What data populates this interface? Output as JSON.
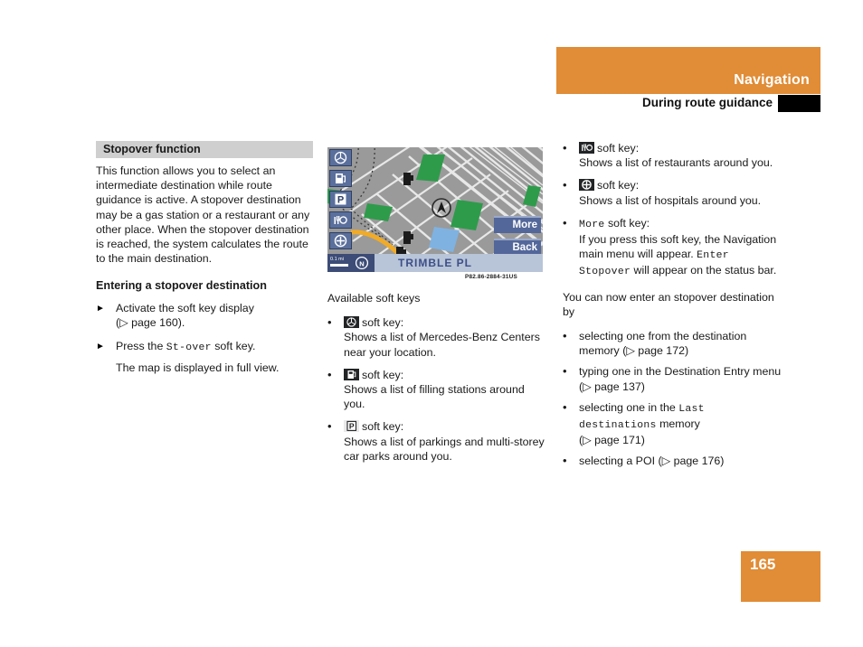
{
  "header": {
    "title": "Navigation",
    "subtitle": "During route guidance",
    "accent_color": "#e18c36",
    "bar_color": "#000000"
  },
  "left_column": {
    "section_heading": "Stopover function",
    "intro": "This function allows you to select an intermediate destination while route guidance is active. A stopover destination may be a gas station or a restaurant or any other place. When the stopover destination is reached, the system calculates the route to the main destination.",
    "sub_heading": "Entering a stopover destination",
    "steps": [
      {
        "text_before": "Activate the soft key display",
        "ref": "(▷ page 160).",
        "mono": "",
        "text_after": ""
      },
      {
        "text_before": "Press the ",
        "mono": "St-over",
        "text_after": " soft key.",
        "ref": ""
      }
    ],
    "step_note": "The map is displayed in full view."
  },
  "figure": {
    "code": "P82.86-2884-31US",
    "street_label": "TRIMBLE PL",
    "scale_label": "0.1 mi",
    "north_icon": "compass-north-icon",
    "soft_keys_left": [
      {
        "name": "mercedes-star-key",
        "label": "Mercedes-Benz Centers"
      },
      {
        "name": "fuel-pump-key",
        "label": "Filling stations"
      },
      {
        "name": "parking-key",
        "label": "Parkings"
      },
      {
        "name": "restaurant-key",
        "label": "Restaurants"
      },
      {
        "name": "hospital-key",
        "label": "Hospitals"
      }
    ],
    "soft_keys_right": [
      {
        "name": "more-key",
        "label": "More"
      },
      {
        "name": "back-key",
        "label": "Back"
      }
    ],
    "map_colors": {
      "background": "#9a9a9a",
      "roads": "#e8e8e8",
      "park": "#2e9b4a",
      "water": "#7fb2e0",
      "route": "#f0ab28"
    }
  },
  "mid_column": {
    "lead": "Available soft keys",
    "items": [
      {
        "icon": "mercedes-star-icon",
        "key_line": "soft key:",
        "description": "Shows a list of Mercedes-Benz Centers near your location."
      },
      {
        "icon": "fuel-pump-icon",
        "key_line": "soft key:",
        "description": "Shows a list of filling stations around you."
      },
      {
        "icon": "parking-icon",
        "key_line": "soft key:",
        "description": "Shows a list of parkings and multi-storey car parks around you."
      }
    ]
  },
  "right_column": {
    "items": [
      {
        "icon": "restaurant-icon",
        "key_line": "soft key:",
        "description": "Shows a list of restaurants around you."
      },
      {
        "icon": "hospital-icon",
        "key_line": "soft key:",
        "description": "Shows a list of hospitals around you."
      }
    ],
    "more_item": {
      "mono_key": "More",
      "key_line": " soft key:",
      "line1": "If you press this soft key, the Navigation main menu will appear. ",
      "mono_status": "Enter Stopover",
      "line2": " will appear on the status bar."
    },
    "paragraph": "You can now enter an stopover destination by",
    "options": [
      {
        "text_before": "selecting one from the destination memory ",
        "mono": "",
        "text_after": "",
        "ref": "(▷ page 172)"
      },
      {
        "text_before": "typing one in the Destination Entry menu ",
        "mono": "",
        "text_after": "",
        "ref": "(▷ page 137)"
      },
      {
        "text_before": "selecting one in the ",
        "mono": "Last destinations",
        "text_after": " memory",
        "ref": "(▷ page 171)"
      },
      {
        "text_before": "selecting a POI ",
        "mono": "",
        "text_after": "",
        "ref": "(▷ page 176)"
      }
    ]
  },
  "footer": {
    "page_number": "165"
  }
}
